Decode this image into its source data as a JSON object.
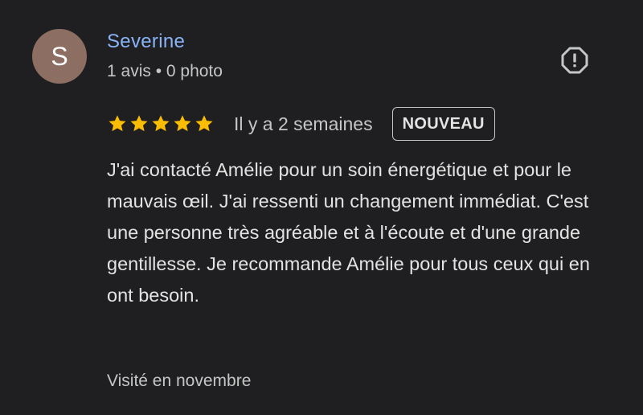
{
  "review": {
    "author": {
      "initial": "S",
      "name": "Severine",
      "meta": "1 avis • 0 photo"
    },
    "rating": 5,
    "rating_max": 5,
    "date": "Il y a 2 semaines",
    "badge": "NOUVEAU",
    "text": "J'ai contacté Amélie pour un soin énergétique et pour le mauvais œil. J'ai ressenti un changement immédiat. C'est une personne très agréable et à l'écoute et d'une grande gentillesse. Je recommande Amélie pour tous ceux qui en ont besoin.",
    "visit": "Visité en novembre",
    "report_icon": "report-octagon-icon"
  },
  "colors": {
    "background": "#1f1f21",
    "author_name": "#8ab4f8",
    "avatar": "#8d6e63",
    "star": "#fbbc04",
    "muted_text": "#c4c7c5"
  }
}
